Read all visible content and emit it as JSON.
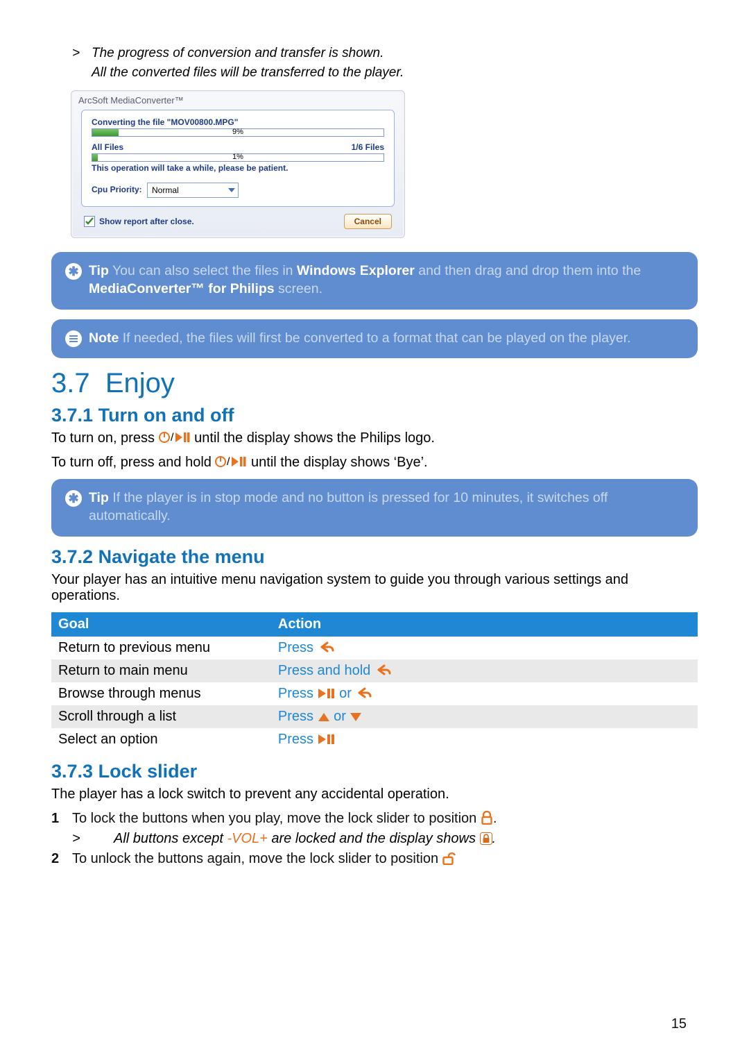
{
  "intro": {
    "line1": "The progress of conversion and transfer is shown.",
    "line2": "All the converted files will be transferred to the player.",
    "caret": ">"
  },
  "dialog": {
    "title": "ArcSoft MediaConverter™",
    "converting_label": "Converting the file \"MOV00800.MPG\"",
    "converting_pct": "9%",
    "converting_width": "9%",
    "allfiles_label": "All Files",
    "allfiles_count": "1/6 Files",
    "allfiles_pct": "1%",
    "allfiles_width": "2%",
    "patience": "This operation will take a while, please be patient.",
    "cpu_label": "Cpu Priority:",
    "cpu_value": "Normal",
    "show_report": "Show report after close.",
    "cancel": "Cancel"
  },
  "tips": {
    "tip_label": "Tip",
    "note_label": "Note",
    "tip1_pre": "You can also select the files in ",
    "tip1_strong1": "Windows Explorer",
    "tip1_mid": " and then drag and drop them into the ",
    "tip1_strong2": "MediaConverter™ for Philips",
    "tip1_post": " screen.",
    "note1": "If needed, the files will first be converted to a format that can be played on the player.",
    "tip2": "If the player is in stop mode and no button is pressed for 10 minutes, it switches off automatically."
  },
  "s37": {
    "num": "3.7",
    "title": "Enjoy"
  },
  "s371": {
    "num": "3.7.1",
    "title": "Turn on and off",
    "on_pre": "To turn on, press ",
    "on_post": " until the display shows the Philips logo.",
    "off_pre": "To turn off, press and hold ",
    "off_post": " until the display shows ‘Bye’."
  },
  "s372": {
    "num": "3.7.2",
    "title": "Navigate the menu",
    "intro": "Your player has an intuitive menu navigation system to guide you through various settings and operations.",
    "headers": {
      "goal": "Goal",
      "action": "Action"
    },
    "rows": [
      {
        "goal": "Return to previous menu",
        "action_pre": "Press ",
        "icons": [
          "back"
        ]
      },
      {
        "goal": "Return to main menu",
        "action_pre": "Press and hold ",
        "icons": [
          "back"
        ]
      },
      {
        "goal": "Browse through menus",
        "action_pre": "Press ",
        "action_mid": " or ",
        "icons": [
          "playpause",
          "back"
        ]
      },
      {
        "goal": "Scroll through a list",
        "action_pre": "Press ",
        "action_mid": " or ",
        "icons": [
          "up",
          "down"
        ]
      },
      {
        "goal": "Select an option",
        "action_pre": "Press ",
        "icons": [
          "playpause"
        ]
      }
    ]
  },
  "s373": {
    "num": "3.7.3",
    "title": "Lock slider",
    "intro": "The player has a lock switch to prevent any accidental operation.",
    "step1_pre": "To lock the buttons when you play, move the lock slider to position ",
    "step1_post": ".",
    "step1_sub_pre": "All buttons except ",
    "step1_sub_vol": "-VOL+",
    "step1_sub_mid": " are locked and the display shows ",
    "step1_sub_post": ".",
    "step2_pre": "To unlock the buttons again, move the lock slider to position "
  },
  "page_number": "15"
}
